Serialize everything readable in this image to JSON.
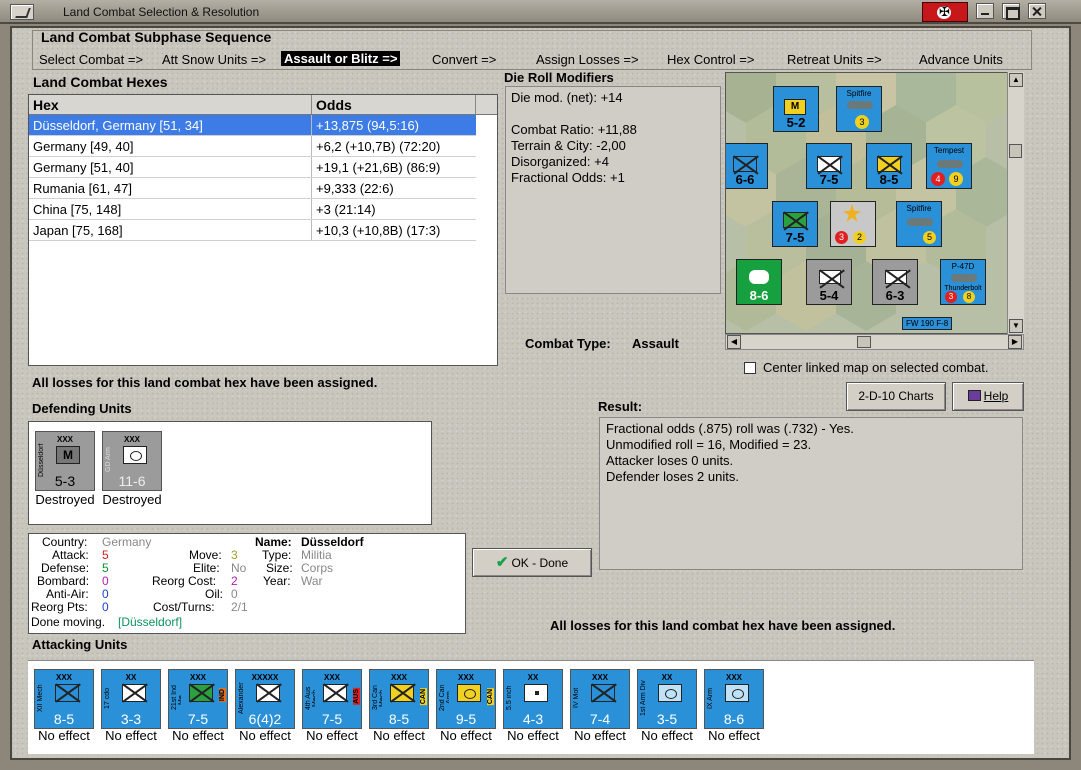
{
  "window": {
    "title": "Land Combat Selection & Resolution"
  },
  "sequence": {
    "title": "Land Combat Subphase Sequence",
    "steps": [
      "Select Combat =>",
      "Att Snow Units =>",
      "Assault or Blitz =>",
      "Convert =>",
      "Assign Losses =>",
      "Hex Control =>",
      "Retreat Units =>",
      "Advance Units"
    ],
    "active_index": 2
  },
  "hexes": {
    "label": "Land Combat Hexes",
    "col_hex": "Hex",
    "col_odds": "Odds",
    "rows": [
      {
        "hex": "Düsseldorf, Germany [51, 34]",
        "odds": "+13,875 (94,5:16)"
      },
      {
        "hex": "Germany [49, 40]",
        "odds": "+6,2 (+10,7B) (72:20)"
      },
      {
        "hex": "Germany [51, 40]",
        "odds": "+19,1 (+21,6B) (86:9)"
      },
      {
        "hex": "Rumania [61, 47]",
        "odds": "+9,333 (22:6)"
      },
      {
        "hex": "China [75, 148]",
        "odds": "+3 (21:14)"
      },
      {
        "hex": "Japan [75, 168]",
        "odds": "+10,3 (+10,8B) (17:3)"
      }
    ],
    "selected_index": 0
  },
  "die_roll": {
    "label": "Die Roll Modifiers",
    "net": "Die mod. (net): +14",
    "lines": [
      "Combat Ratio: +11,88",
      "Terrain & City: -2,00",
      "Disorganized: +4",
      "Fractional Odds: +1"
    ]
  },
  "combat_type": {
    "label": "Combat Type:",
    "value": "Assault"
  },
  "center_map": {
    "label": "Center linked map on selected combat.",
    "checked": false
  },
  "losses_msg": "All losses for this land combat hex have been assigned.",
  "losses_msg2": "All losses for this land combat hex have been assigned.",
  "buttons": {
    "charts": "2-D-10 Charts",
    "help": "Help",
    "ok": "OK - Done"
  },
  "result": {
    "label": "Result:",
    "lines": [
      "Fractional odds (.875) roll was (.732)  - Yes.",
      "Unmodified roll = 16, Modified = 23.",
      "Attacker loses 0 units.",
      "Defender loses 2 units."
    ]
  },
  "defending": {
    "label": "Defending Units",
    "units": [
      {
        "size": "XXX",
        "name": "Düsseldorf",
        "symbol": "M",
        "strength": "5-3",
        "status": "Destroyed"
      },
      {
        "size": "XXX",
        "name": "GD Arm",
        "symbol": "",
        "strength": "11-6",
        "status": "Destroyed"
      }
    ]
  },
  "unit_info": {
    "country_label": "Country:",
    "country": "Germany",
    "attack_label": "Attack:",
    "attack": "5",
    "defense_label": "Defense:",
    "defense": "5",
    "bombard_label": "Bombard:",
    "bombard": "0",
    "antiair_label": "Anti-Air:",
    "antiair": "0",
    "reorgpts_label": "Reorg Pts:",
    "reorgpts": "0",
    "move_label": "Move:",
    "move": "3",
    "elite_label": "Elite:",
    "elite": "No",
    "reorgcost_label": "Reorg Cost:",
    "reorgcost": "2",
    "oil_label": "Oil:",
    "oil": "0",
    "costturns_label": "Cost/Turns:",
    "costturns": "2/1",
    "name_label": "Name:",
    "name": "Düsseldorf",
    "type_label": "Type:",
    "type": "Militia",
    "size_label": "Size:",
    "size": "Corps",
    "year_label": "Year:",
    "year": "War",
    "done_label": "Done moving.",
    "done_loc": "[Düsseldorf]"
  },
  "attacking": {
    "label": "Attacking Units",
    "units": [
      {
        "size": "XXX",
        "name": "XII Mech",
        "sym": "x",
        "strength": "8-5",
        "nat": "",
        "status": "No effect"
      },
      {
        "size": "XX",
        "name": "17 cdo",
        "sym": "para",
        "strength": "3-3",
        "nat": "",
        "status": "No effect"
      },
      {
        "size": "XXX",
        "name": "21st Ind Me..",
        "sym": "x",
        "strength": "7-5",
        "nat": "IND",
        "status": "No effect"
      },
      {
        "size": "XXXXX",
        "name": "Alexander",
        "sym": "x",
        "strength": "6(4)2",
        "nat": "",
        "status": "No effect"
      },
      {
        "size": "XXX",
        "name": "4th Aus Mech",
        "sym": "x",
        "strength": "7-5",
        "nat": "AUS",
        "status": "No effect"
      },
      {
        "size": "XXX",
        "name": "3rd Can Mech",
        "sym": "x",
        "strength": "8-5",
        "nat": "CAN",
        "status": "No effect"
      },
      {
        "size": "XXX",
        "name": "2nd Can Arm",
        "sym": "arm",
        "strength": "9-5",
        "nat": "CAN",
        "status": "No effect"
      },
      {
        "size": "XX",
        "name": "5.5 inch",
        "sym": "dot",
        "strength": "4-3",
        "nat": "",
        "status": "No effect"
      },
      {
        "size": "XXX",
        "name": "IV Mot",
        "sym": "x",
        "strength": "7-4",
        "nat": "",
        "status": "No effect"
      },
      {
        "size": "XX",
        "name": "1st Arm Div",
        "sym": "arm",
        "strength": "3-5",
        "nat": "",
        "status": "No effect"
      },
      {
        "size": "XXX",
        "name": "IX Arm",
        "sym": "arm",
        "strength": "8-6",
        "nat": "",
        "status": "No effect"
      }
    ]
  },
  "colors": {
    "selected_row": "#3d7ce6",
    "unit_blue": "#2a90d8",
    "unit_grey": "#9b9b9b",
    "accent_green": "#18a04a"
  },
  "map": {
    "counters": [
      {
        "strength": "5-2",
        "style": "yellow"
      },
      {
        "strength": "6-6"
      },
      {
        "strength": "7-5"
      },
      {
        "strength": "8-5"
      },
      {
        "strength": "7-5"
      },
      {
        "strength": "8-6"
      },
      {
        "strength": "5-4"
      },
      {
        "strength": "6-3"
      }
    ],
    "labels": [
      "Spitfire",
      "Tempest",
      "P-47D",
      "Thunderbolt",
      "FW 190 F-8"
    ]
  }
}
